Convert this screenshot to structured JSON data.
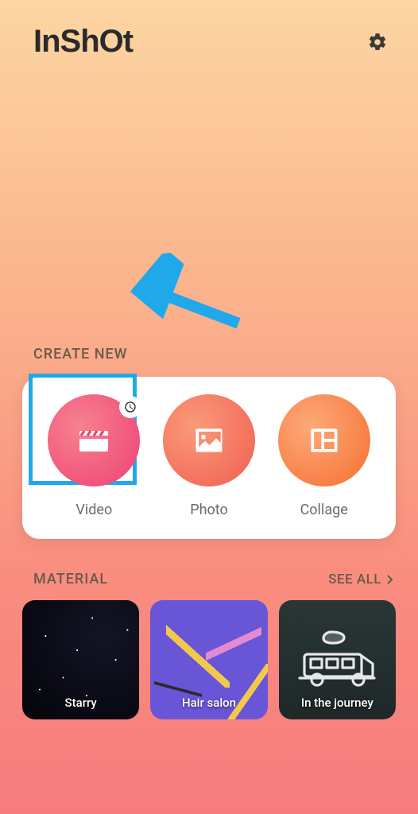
{
  "header": {
    "logo_text": "InShOt"
  },
  "create": {
    "title": "CREATE NEW",
    "items": [
      {
        "label": "Video",
        "has_history_badge": true
      },
      {
        "label": "Photo",
        "has_history_badge": false
      },
      {
        "label": "Collage",
        "has_history_badge": false
      }
    ]
  },
  "material": {
    "title": "MATERIAL",
    "see_all_label": "SEE ALL",
    "items": [
      {
        "label": "Starry"
      },
      {
        "label": "Hair salon"
      },
      {
        "label": "In the journey"
      }
    ]
  },
  "annotations": {
    "arrow_points_to": "video-button"
  }
}
